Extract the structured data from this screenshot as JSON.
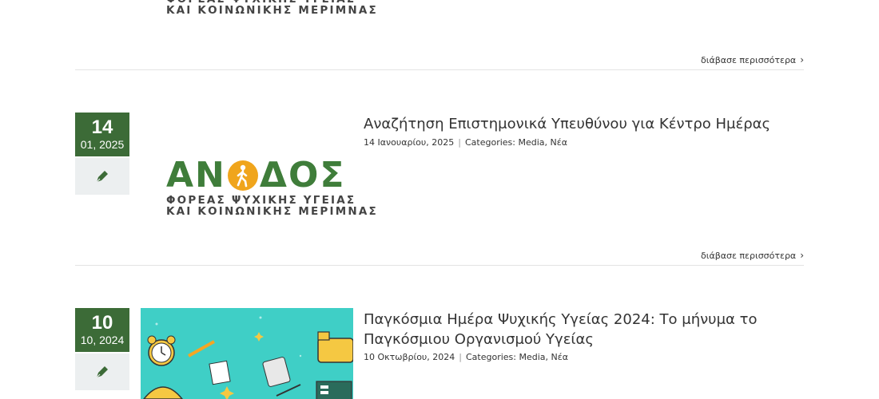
{
  "logo": {
    "brand_left": "ΑΝ",
    "brand_right": "ΔΟΣ",
    "sub_line1": "ΦΟΡΕΑΣ ΨΥΧΙΚΗΣ ΥΓΕΙΑΣ",
    "sub_line2": "ΚΑΙ ΚΟΙΝΩΝΙΚΗΣ ΜΕΡΙΜΝΑΣ"
  },
  "read_more": "διάβασε περισσότερα",
  "colors": {
    "date_green": "#3c6b37",
    "logo_green": "#3f7d3a",
    "logo_orange": "#f0a51c",
    "thumb_teal": "#3fcfc6"
  },
  "posts": [
    {
      "day": "14",
      "month_year": "01, 2025",
      "title": "Αναζήτηση Επιστημονικά Υπευθύνου για Κέντρο Ημέρας",
      "date": "14 Ιανουαρίου, 2025",
      "categories_label": "Categories:",
      "categories": "Media, Νέα",
      "format_icon": "pen-icon"
    },
    {
      "day": "10",
      "month_year": "10, 2024",
      "title": "Παγκόσμια Ημέρα Ψυχικής Υγείας 2024: Το μήνυμα το Παγκόσμιου Οργανισμού Υγείας",
      "date": "10 Οκτωβρίου, 2024",
      "categories_label": "Categories:",
      "categories": "Media, Νέα",
      "format_icon": "pen-icon"
    }
  ]
}
